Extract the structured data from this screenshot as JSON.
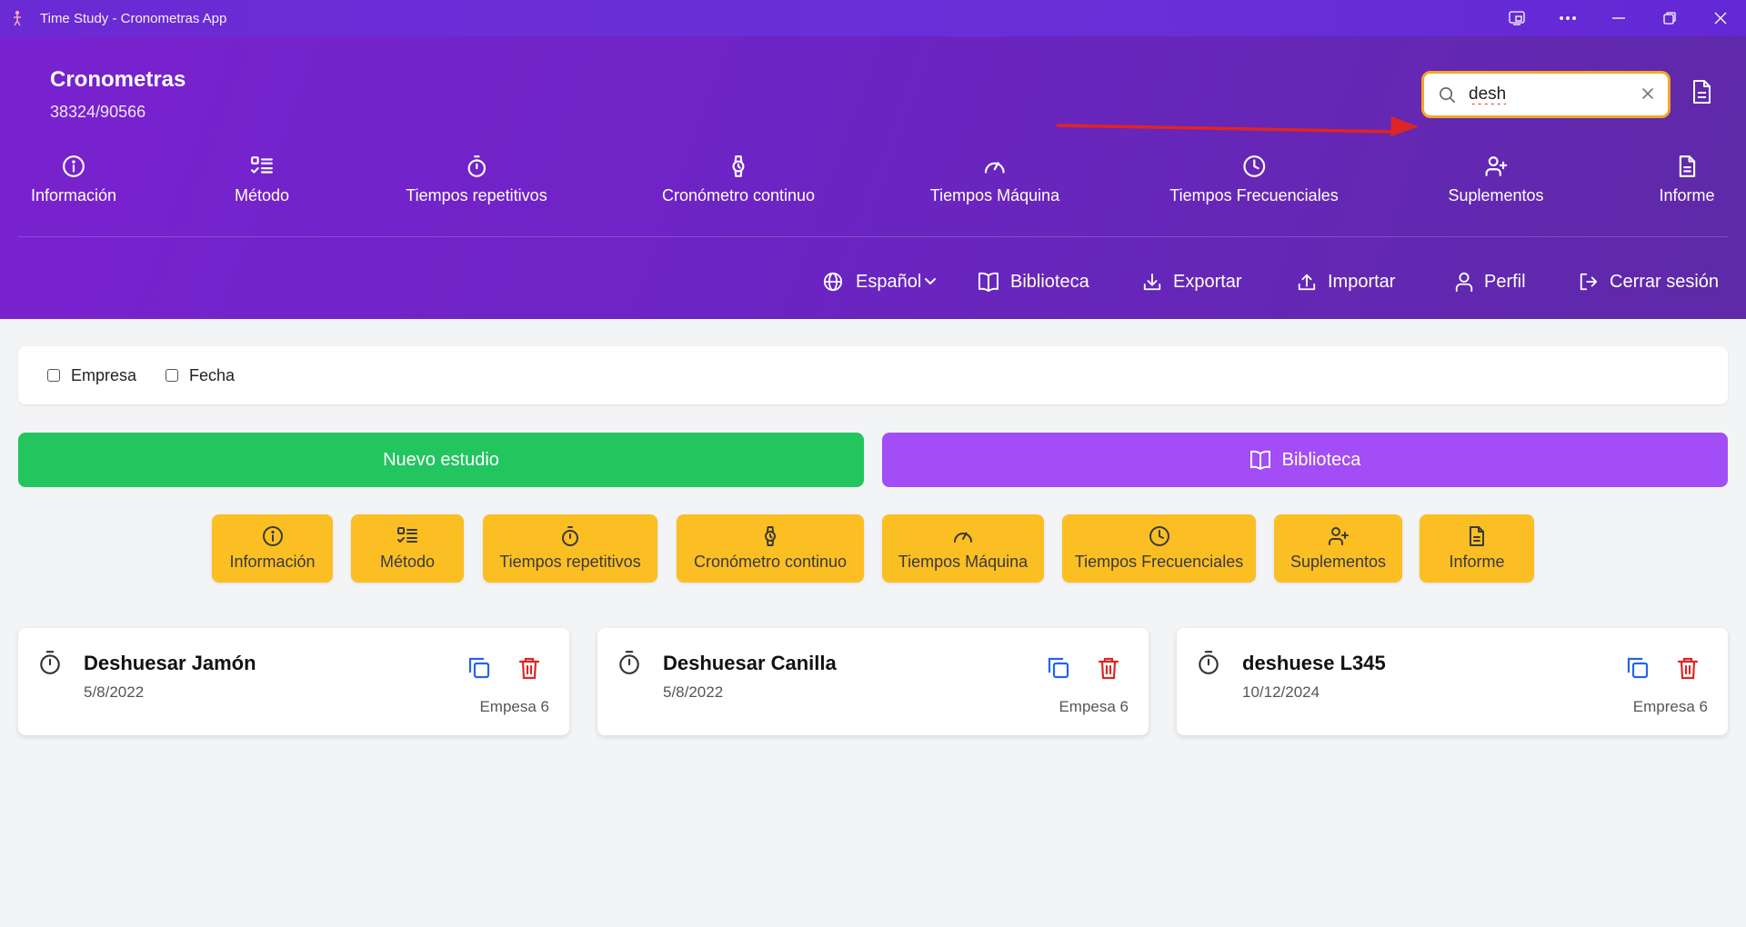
{
  "window": {
    "title": "Time Study - Cronometras App"
  },
  "header": {
    "brand": "Cronometras",
    "subtitle": "38324/90566",
    "search": {
      "value": "desh",
      "placeholder": ""
    }
  },
  "nav": {
    "items": [
      {
        "label": "Información",
        "icon": "info-icon"
      },
      {
        "label": "Método",
        "icon": "list-check-icon"
      },
      {
        "label": "Tiempos repetitivos",
        "icon": "timer-icon"
      },
      {
        "label": "Cronómetro continuo",
        "icon": "watch-icon"
      },
      {
        "label": "Tiempos Máquina",
        "icon": "gauge-icon"
      },
      {
        "label": "Tiempos Frecuenciales",
        "icon": "clock-icon"
      },
      {
        "label": "Suplementos",
        "icon": "user-plus-icon"
      },
      {
        "label": "Informe",
        "icon": "document-icon"
      }
    ]
  },
  "toolbar": {
    "language": "Español",
    "library": "Biblioteca",
    "export": "Exportar",
    "import": "Importar",
    "profile": "Perfil",
    "logout": "Cerrar sesión"
  },
  "filters": {
    "company": "Empresa",
    "date": "Fecha"
  },
  "actions": {
    "new_study": "Nuevo estudio",
    "library": "Biblioteca"
  },
  "modules": {
    "items": [
      {
        "label": "Información",
        "icon": "info-icon"
      },
      {
        "label": "Método",
        "icon": "list-check-icon"
      },
      {
        "label": "Tiempos repetitivos",
        "icon": "timer-icon"
      },
      {
        "label": "Cronómetro continuo",
        "icon": "watch-icon"
      },
      {
        "label": "Tiempos Máquina",
        "icon": "gauge-icon"
      },
      {
        "label": "Tiempos Frecuenciales",
        "icon": "clock-icon"
      },
      {
        "label": "Suplementos",
        "icon": "user-plus-icon"
      },
      {
        "label": "Informe",
        "icon": "document-icon"
      }
    ]
  },
  "studies": [
    {
      "title": "Deshuesar Jamón",
      "date": "5/8/2022",
      "company": "Empesa 6"
    },
    {
      "title": "Deshuesar Canilla",
      "date": "5/8/2022",
      "company": "Empesa 6"
    },
    {
      "title": "deshuese L345",
      "date": "10/12/2024",
      "company": "Empresa 6"
    }
  ],
  "colors": {
    "header_gradient_start": "#7a22d0",
    "header_gradient_end": "#5e2aa8",
    "new_study": "#22c55e",
    "library": "#a24df5",
    "module": "#fbbf24",
    "search_border": "#f5a524",
    "copy_icon": "#2563eb",
    "delete_icon": "#dc2626",
    "annotation_arrow": "#e02424"
  }
}
